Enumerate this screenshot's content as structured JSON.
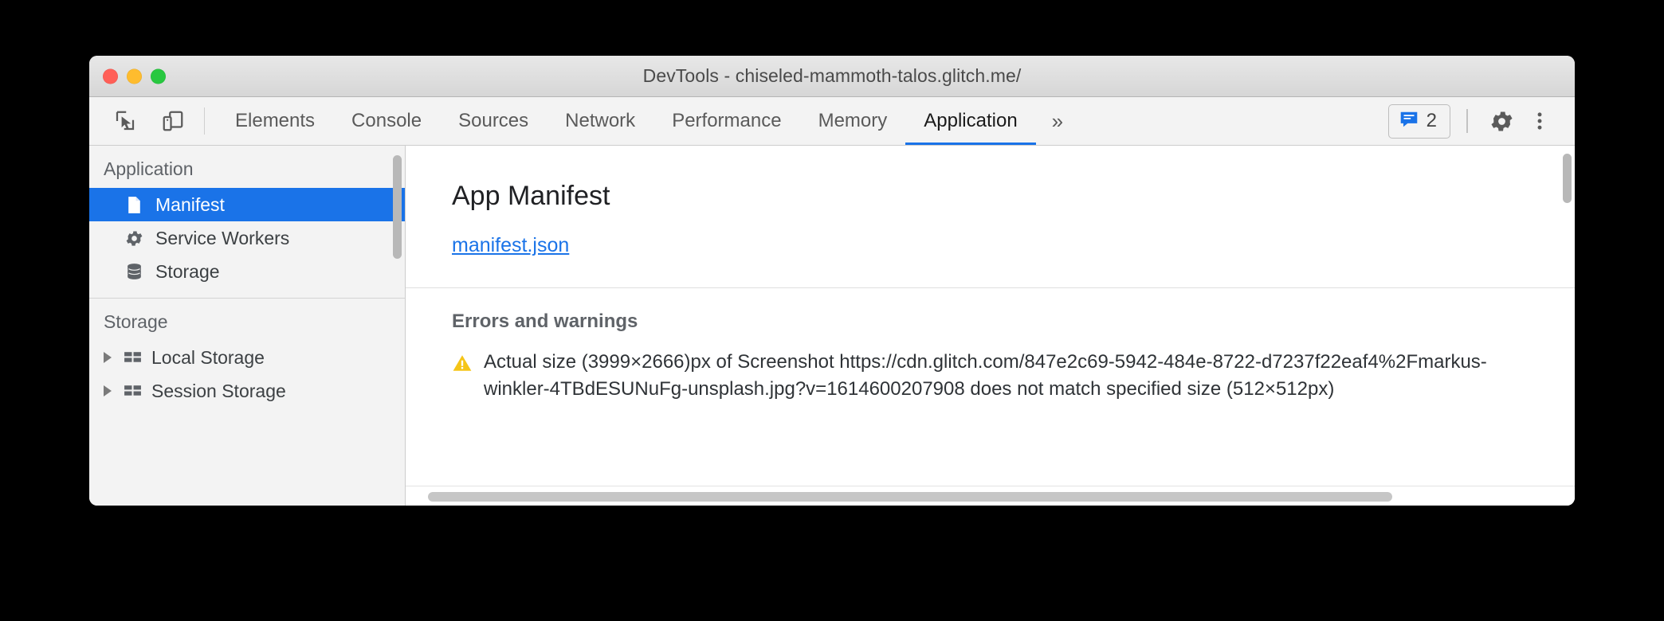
{
  "window": {
    "title": "DevTools - chiseled-mammoth-talos.glitch.me/",
    "traffic_lights": [
      {
        "name": "close",
        "color": "#ff5f57"
      },
      {
        "name": "minimize",
        "color": "#febc2e"
      },
      {
        "name": "maximize",
        "color": "#28c840"
      }
    ]
  },
  "toolbar": {
    "inspect_icon": "inspect-element-icon",
    "device_toolbar_icon": "device-toolbar-icon",
    "tabs": [
      {
        "label": "Elements",
        "active": false
      },
      {
        "label": "Console",
        "active": false
      },
      {
        "label": "Sources",
        "active": false
      },
      {
        "label": "Network",
        "active": false
      },
      {
        "label": "Performance",
        "active": false
      },
      {
        "label": "Memory",
        "active": false
      },
      {
        "label": "Application",
        "active": true
      }
    ],
    "overflow_label": "»",
    "message_badge": {
      "icon": "message-bubble-icon",
      "count": "2",
      "color": "#1a73e8"
    },
    "settings_icon": "gear-icon",
    "more_icon": "kebab-menu-icon",
    "active_tab_underline_color": "#1a73e8"
  },
  "sidebar": {
    "sections": [
      {
        "title": "Application",
        "items": [
          {
            "label": "Manifest",
            "icon": "document-icon",
            "selected": true,
            "expandable": false
          },
          {
            "label": "Service Workers",
            "icon": "gear-icon",
            "selected": false,
            "expandable": false
          },
          {
            "label": "Storage",
            "icon": "database-icon",
            "selected": false,
            "expandable": false
          }
        ]
      },
      {
        "title": "Storage",
        "items": [
          {
            "label": "Local Storage",
            "icon": "table-icon",
            "selected": false,
            "expandable": true
          },
          {
            "label": "Session Storage",
            "icon": "table-icon",
            "selected": false,
            "expandable": true
          }
        ]
      }
    ],
    "selection_color": "#1a73e8"
  },
  "main": {
    "heading": "App Manifest",
    "manifest_link": "manifest.json",
    "errors_heading": "Errors and warnings",
    "warning": {
      "icon": "warning-triangle-icon",
      "icon_color": "#f5c518",
      "text": "Actual size (3999×2666)px of Screenshot https://cdn.glitch.com/847e2c69-5942-484e-8722-d7237f22eaf4%2Fmarkus-winkler-4TBdESUNuFg-unsplash.jpg?v=1614600207908 does not match specified size (512×512px)"
    }
  }
}
